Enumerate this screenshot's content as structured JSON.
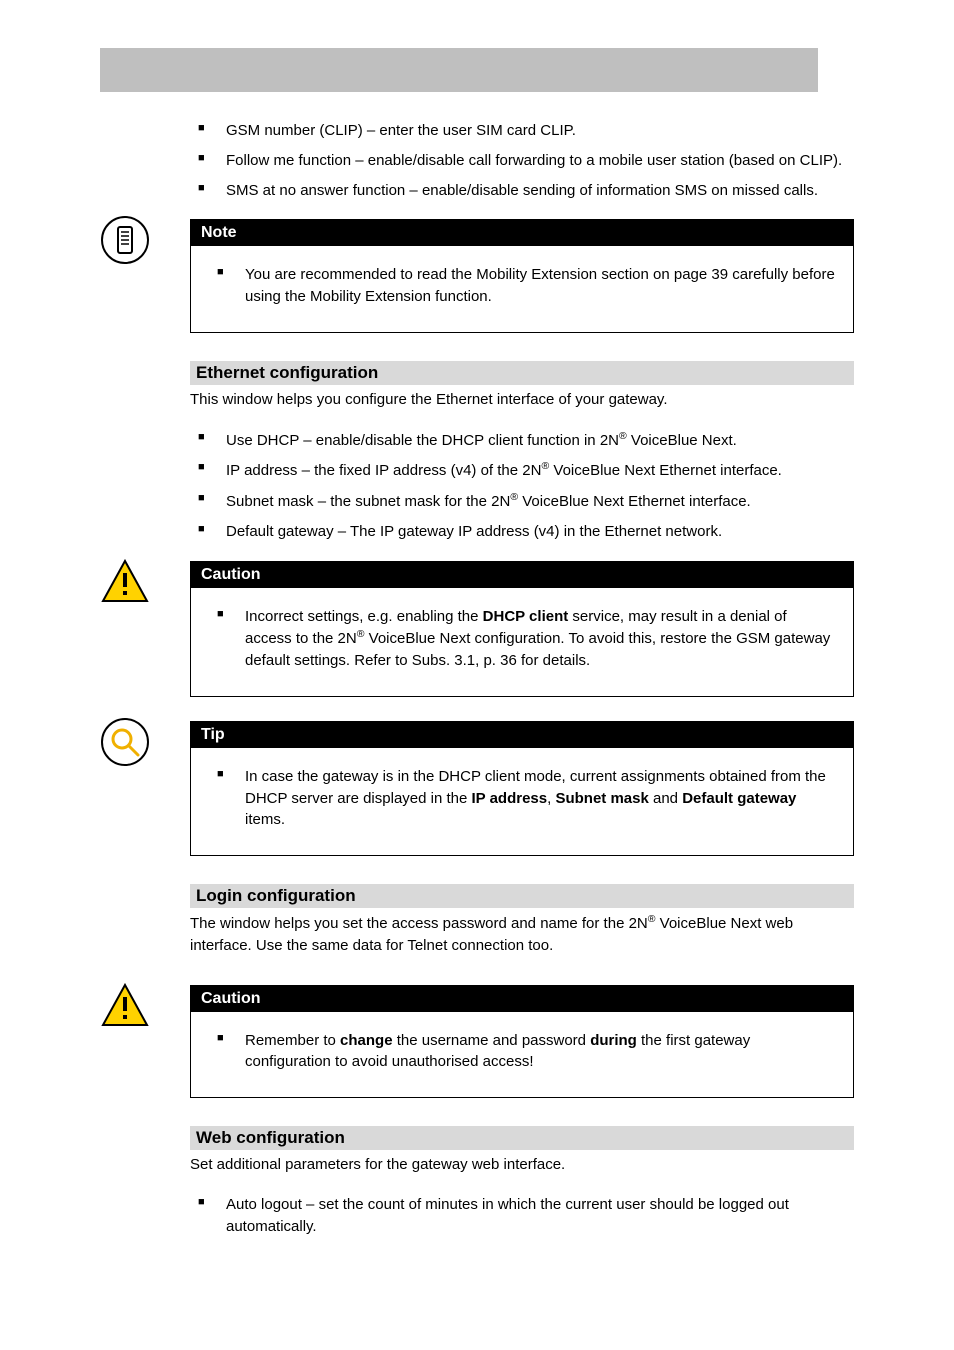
{
  "intro_bullets": [
    "GSM number (CLIP) – enter the user SIM card CLIP.",
    "Follow me function – enable/disable call forwarding to a mobile user station (based on CLIP).",
    "SMS at no answer function – enable/disable sending of information SMS on missed calls."
  ],
  "note": {
    "title": "Note",
    "body": "You are recommended to read the Mobility Extension section on page 39 carefully before using the Mobility Extension function."
  },
  "ethernet": {
    "heading": "Ethernet configuration",
    "intro": "This window helps you configure the Ethernet interface of your gateway.",
    "bullets": {
      "dhcp_pre": "Use DHCP – enable/disable the DHCP client function in 2N",
      "dhcp_post": " VoiceBlue Next.",
      "ip_pre": "IP address – the fixed IP address (v4) of the 2N",
      "ip_post": " VoiceBlue Next Ethernet interface.",
      "subnet_pre": "Subnet mask – the subnet mask for the 2N",
      "subnet_post": " VoiceBlue Next Ethernet interface.",
      "gw": "Default gateway – The IP gateway IP address (v4) in the Ethernet network."
    }
  },
  "caution1": {
    "title": "Caution",
    "pre": "Incorrect settings, e.g. enabling the ",
    "bold1": "DHCP client",
    "mid": " service, may result in a denial of access to the 2N",
    "post": " VoiceBlue Next configuration. To avoid this, restore the GSM gateway default settings. Refer to Subs. 3.1, p. 36 for details."
  },
  "tip": {
    "title": "Tip",
    "pre": "In case the gateway is in the DHCP client mode, current assignments obtained from the DHCP server are displayed in the ",
    "b1": "IP address",
    "sep1": ", ",
    "b2": "Subnet mask",
    "sep2": " and ",
    "b3": "Default gateway",
    "post": " items."
  },
  "login": {
    "heading": "Login configuration",
    "pre": "The window helps you set the access password and name for the 2N",
    "post": " VoiceBlue Next web interface. Use the same data for Telnet connection too."
  },
  "caution2": {
    "title": "Caution",
    "pre": "Remember to ",
    "b1": "change",
    "mid": " the username and password ",
    "b2": "during",
    "post": " the first gateway configuration to avoid unauthorised access!"
  },
  "web": {
    "heading": "Web configuration",
    "intro": "Set additional parameters for the gateway web interface.",
    "bullet": "Auto logout – set the count of minutes in which the current user should be logged out automatically."
  },
  "reg": "®"
}
